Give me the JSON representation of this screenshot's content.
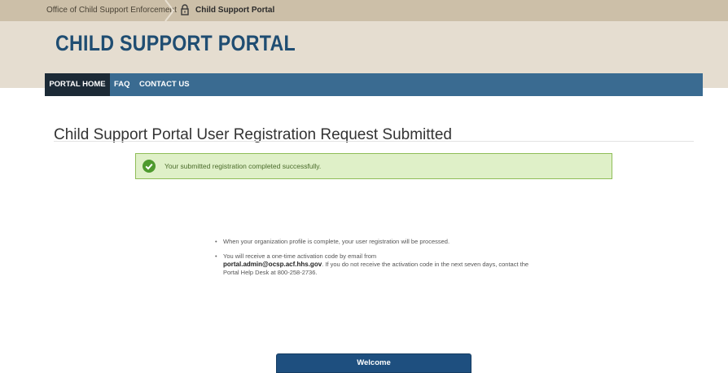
{
  "breadcrumb": {
    "office": "Office of Child Support Enforcement",
    "portal": "Child Support Portal"
  },
  "header": {
    "title": "CHILD SUPPORT PORTAL"
  },
  "nav": {
    "items": [
      {
        "label": "PORTAL HOME",
        "active": true
      },
      {
        "label": "FAQ",
        "active": false
      },
      {
        "label": "CONTACT US",
        "active": false
      }
    ]
  },
  "main": {
    "heading": "Child Support Portal User Registration Request Submitted",
    "alert": {
      "status": "success",
      "message": "Your submitted registration completed successfully."
    },
    "info": {
      "item1": "When your organization profile is complete, your user registration will be processed.",
      "item2_prefix": "You will receive a one-time activation code by email from",
      "item2_email": "portal.admin@ocsp.acf.hhs.gov",
      "item2_suffix": ". If you do not receive the activation code in the next seven days, contact the Portal Help Desk at 800-258-2736."
    },
    "button": {
      "label": "Welcome"
    }
  },
  "colors": {
    "header_band": "#e5ddd0",
    "breadcrumb_bar": "#ccbfa8",
    "title": "#1f4d72",
    "nav": "#3a6b91",
    "nav_active": "#1c2a36",
    "alert_bg": "#dff0c8",
    "alert_border": "#8fbd58",
    "alert_icon": "#4e9a2e",
    "button": "#1e4f7f"
  },
  "icons": {
    "breadcrumb": "lock-icon",
    "alert": "check-circle-icon"
  }
}
